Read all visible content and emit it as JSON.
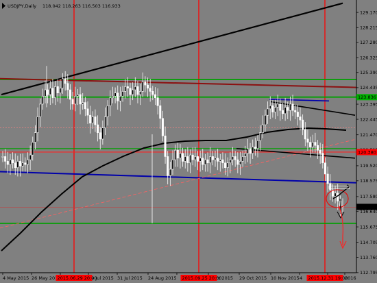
{
  "header": {
    "symbol": "USDJPY,Daily",
    "ohlc": "118.042 118.263 116.503 116.933"
  },
  "chart_data": {
    "type": "candlestick",
    "symbol": "USDJPY",
    "timeframe": "Daily",
    "ylim": [
      112.79,
      129.95
    ],
    "y_ticks": [
      "129.170",
      "128.215",
      "127.280",
      "126.325",
      "125.390",
      "124.435",
      "123.395",
      "122.445",
      "121.470",
      "120.515",
      "119.520",
      "118.575",
      "117.580",
      "116.640",
      "115.675",
      "114.705",
      "113.760",
      "112.795"
    ],
    "x_ticks": [
      "4 May 2015",
      "26 May 2015",
      "",
      "19 Jul 2015",
      "31 Jul 2015",
      "24 Aug 2015",
      "",
      "7 Oct 2015",
      "29 Oct 2015",
      "10 Nov 2015",
      "4",
      "",
      "2016"
    ],
    "x_highlight_labels": [
      "2015.06.29 20:00",
      "2015.09.25 20:00",
      "2015.12.31 19:00"
    ],
    "price_labels": [
      {
        "text": "123.836",
        "value": 123.836,
        "color": "#00b000"
      },
      {
        "text": "120.380",
        "value": 120.38,
        "color": "#ff0000"
      },
      {
        "text": "116.933",
        "value": 116.933,
        "color": "#000000"
      }
    ],
    "candles_close": [
      120.1,
      119.8,
      119.6,
      119.9,
      119.7,
      119.4,
      119.8,
      119.5,
      119.7,
      119.6,
      119.9,
      120.2,
      121.0,
      121.6,
      122.6,
      123.4,
      123.9,
      124.3,
      124.0,
      124.4,
      123.8,
      124.5,
      124.1,
      124.4,
      125.0,
      124.7,
      124.3,
      123.7,
      123.4,
      123.9,
      124.0,
      123.4,
      123.5,
      123.1,
      122.7,
      122.2,
      122.6,
      122.1,
      121.6,
      121.2,
      121.9,
      122.6,
      123.3,
      123.8,
      123.9,
      124.1,
      123.6,
      123.9,
      124.2,
      124.5,
      124.4,
      124.0,
      124.3,
      124.5,
      124.0,
      124.2,
      124.8,
      124.6,
      124.4,
      124.2,
      124.0,
      123.8,
      123.3,
      122.5,
      121.4,
      120.1,
      118.9,
      119.3,
      119.9,
      120.5,
      120.0,
      120.3,
      119.8,
      120.1,
      119.7,
      120.2,
      119.9,
      120.1,
      119.8,
      120.0,
      119.6,
      119.9,
      119.7,
      120.1,
      119.9,
      120.0,
      119.8,
      119.9,
      119.7,
      119.4,
      119.7,
      119.9,
      120.1,
      119.9,
      119.6,
      119.8,
      120.1,
      120.3,
      120.6,
      120.3,
      120.7,
      120.6,
      121.1,
      121.6,
      122.1,
      122.7,
      123.1,
      123.3,
      122.9,
      123.2,
      123.4,
      123.0,
      122.8,
      123.2,
      123.0,
      123.4,
      123.0,
      122.9,
      122.6,
      122.4,
      121.8,
      121.2,
      121.0,
      120.7,
      121.0,
      120.8,
      120.5,
      120.3,
      119.7,
      119.0,
      118.4,
      118.0,
      117.6,
      117.8,
      117.3,
      117.0,
      116.933
    ]
  },
  "axis_color": "#000000",
  "highlight_label_bg": "#ff0000"
}
